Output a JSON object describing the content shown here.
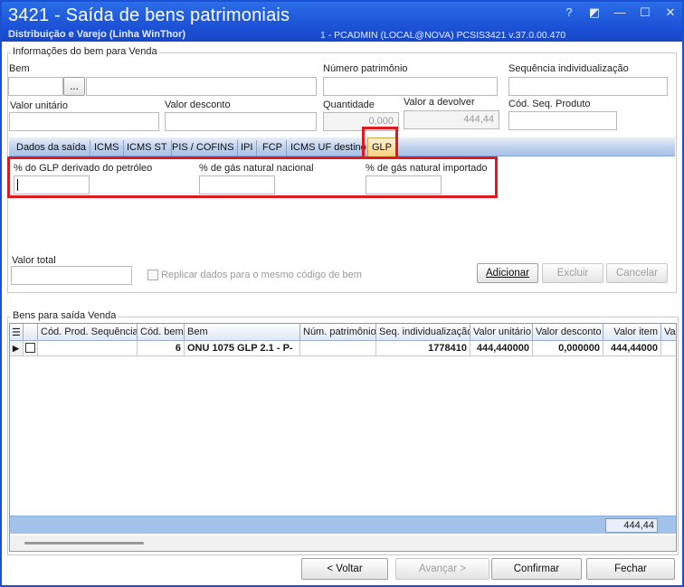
{
  "window": {
    "title": "3421 - Saída de bens patrimoniais",
    "subtitle": "Distribuição e Varejo (Linha WinThor)",
    "info": "1 - PCADMIN (LOCAL@NOVA)   PCSIS3421  v.37.0.00.470",
    "controls": {
      "help": "?",
      "edit": "◩",
      "minimize": "—",
      "maximize": "☐",
      "close": "✕"
    }
  },
  "info_group": {
    "title": "Informações do bem para Venda",
    "bem_label": "Bem",
    "lookup_button": "...",
    "numero_patrimonio_label": "Número patrimônio",
    "sequencia_label": "Sequência individualização",
    "valor_unitario_label": "Valor unitário",
    "valor_desconto_label": "Valor desconto",
    "quantidade_label": "Quantidade",
    "quantidade_value": "0,000",
    "valor_devolver_label": "Valor a devolver",
    "valor_devolver_value": "444,44",
    "cod_seq_label": "Cód. Seq. Produto"
  },
  "tabs": [
    {
      "label": "Dados da saída"
    },
    {
      "label": "ICMS"
    },
    {
      "label": "ICMS ST"
    },
    {
      "label": "PIS / COFINS"
    },
    {
      "label": "IPI"
    },
    {
      "label": "FCP"
    },
    {
      "label": "ICMS UF destino"
    },
    {
      "label": "GLP"
    }
  ],
  "glp": {
    "derivado_label": "% do GLP derivado do petróleo",
    "nacional_label": "% de gás natural nacional",
    "importado_label": "% de gás natural importado"
  },
  "bottom_form": {
    "valor_total_label": "Valor total",
    "replicar_label": "Replicar dados para o mesmo código de bem",
    "adicionar": "Adicionar",
    "excluir": "Excluir",
    "cancelar": "Cancelar"
  },
  "list_group": {
    "title": "Bens para saída Venda",
    "columns": [
      "Cód. Prod. Sequência",
      "Cód. bem",
      "Bem",
      "Núm. patrimônio",
      "Seq. individualização",
      "Valor unitário",
      "Valor desconto",
      "Valor item",
      "Val"
    ],
    "rows": [
      {
        "cod_prod_seq": "",
        "cod_bem": "6",
        "bem": "ONU 1075 GLP 2.1 - P-",
        "num_patrimonio": "",
        "seq_individualizacao": "1778410",
        "valor_unitario": "444,440000",
        "valor_desconto": "0,000000",
        "valor_item": "444,44000"
      }
    ],
    "footer_total": "444,44"
  },
  "footer_buttons": {
    "voltar": "< Voltar",
    "avancar": "Avançar >",
    "confirmar": "Confirmar",
    "fechar": "Fechar"
  },
  "colors": {
    "titlebar": "#1b4fd4",
    "highlight": "#e0191f",
    "active_tab": "#f6cf7e"
  }
}
